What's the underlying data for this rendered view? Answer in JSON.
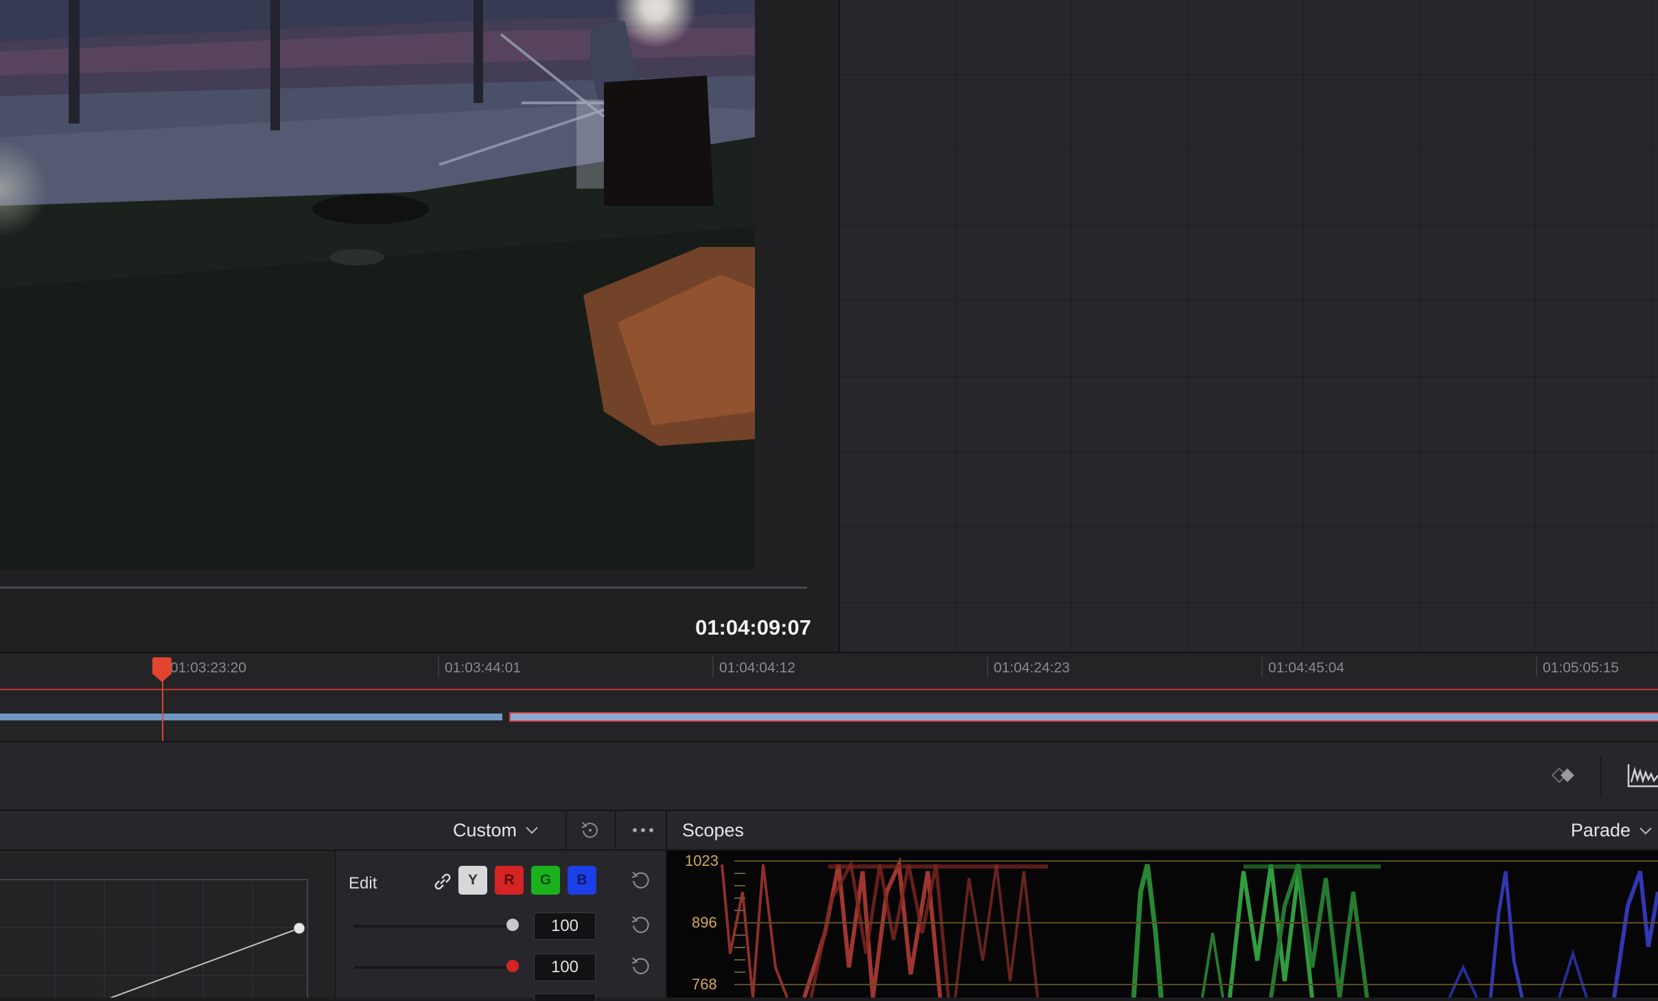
{
  "viewer": {
    "timecode": "01:04:09:07"
  },
  "timeline": {
    "tick_labels": [
      "01:03:23:20",
      "01:03:44:01",
      "01:04:04:12",
      "01:04:24:23",
      "01:04:45:04",
      "01:05:05:15"
    ],
    "playhead_color": "#e2442f",
    "clip_color": "#8fa8cf"
  },
  "curves": {
    "preset": "Custom",
    "edit_label": "Edit",
    "channels": [
      "Y",
      "R",
      "G",
      "B"
    ],
    "channel_colors": {
      "Y": "#d8d8da",
      "R": "#d42424",
      "G": "#19b21c",
      "B": "#1d3fe8"
    },
    "intensity_rows": [
      {
        "value": "100",
        "knob_color": "#c8c8ca"
      },
      {
        "value": "100",
        "knob_color": "#d42424"
      }
    ]
  },
  "scopes": {
    "title": "Scopes",
    "mode": "Parade",
    "scale_labels": [
      "1023",
      "896",
      "768"
    ]
  },
  "icons": {
    "link": "link-icon",
    "reset": "reset-icon",
    "options": "more-options-icon",
    "keyframe": "keyframe-icon",
    "scope_toggle": "waveform-icon",
    "dropdown": "chevron-down-icon"
  }
}
